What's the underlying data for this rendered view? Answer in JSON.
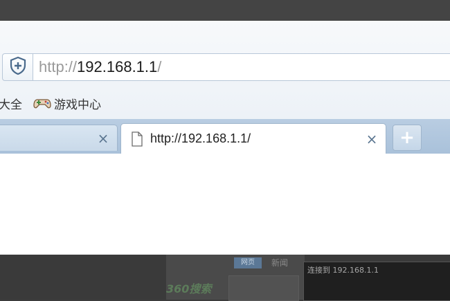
{
  "address_bar": {
    "scheme": "http://",
    "host": "192.168.1.1",
    "path": "/"
  },
  "bookmarks": [
    {
      "label": "大全",
      "icon": "none"
    },
    {
      "label": "游戏中心",
      "icon": "gamepad-icon"
    }
  ],
  "tabs": {
    "inactive_close": "×",
    "active_label": "http://192.168.1.1/",
    "active_close": "×",
    "new_tab": "+"
  },
  "background": {
    "tag": "网页",
    "news": "新闻",
    "logo": "360搜索",
    "dialog_title": "连接到 192.168.1.1"
  },
  "colors": {
    "tabstrip": "#b9cde2",
    "accent": "#5a7590"
  }
}
